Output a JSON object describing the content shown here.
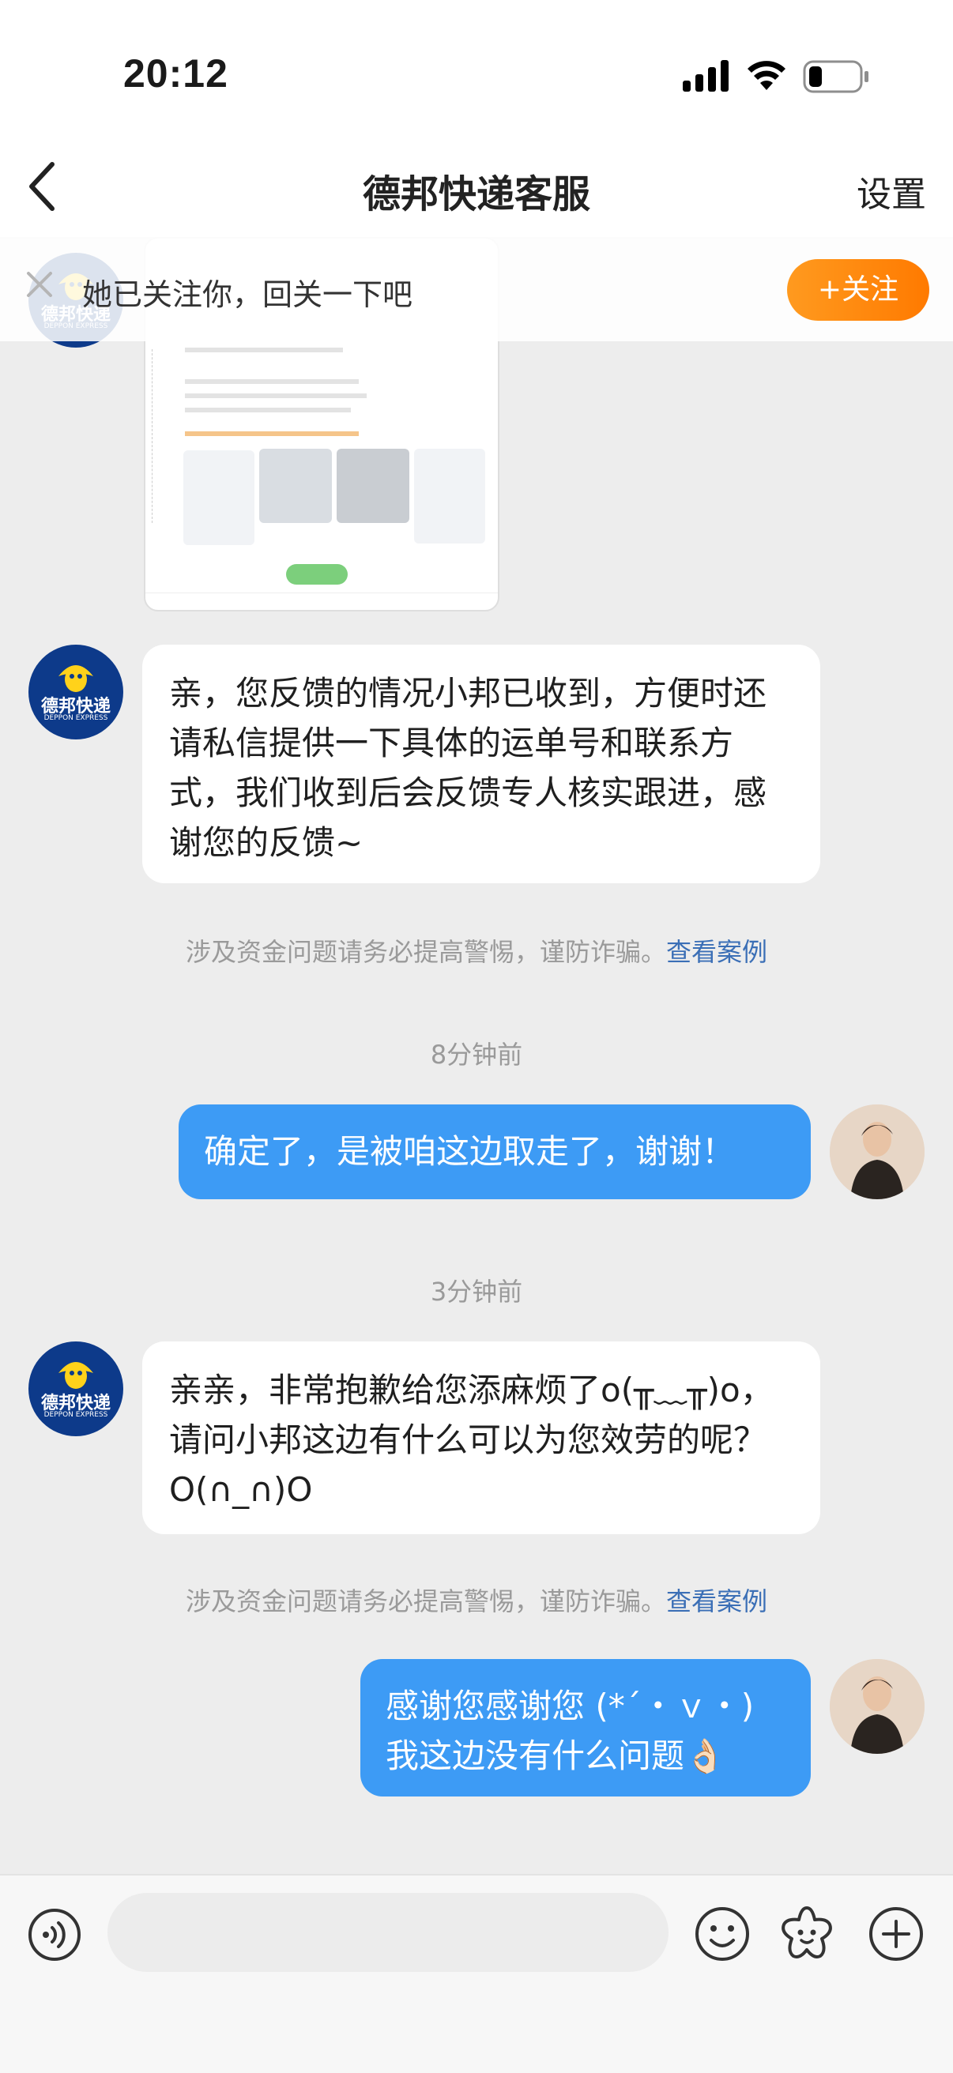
{
  "status_bar": {
    "time": "20:12"
  },
  "nav": {
    "title": "德邦快递客服",
    "settings_label": "设置"
  },
  "follow_banner": {
    "text": "她已关注你，回关一下吧",
    "follow_label": "+关注"
  },
  "bot": {
    "brand_cn": "德邦快递",
    "brand_en": "DEPPON EXPRESS"
  },
  "messages": [
    {
      "sender": "bot",
      "text": "亲，您反馈的情况小邦已收到，方便时还请私信提供一下具体的运单号和联系方式，我们收到后会反馈专人核实跟进，感谢您的反馈~"
    },
    {
      "sender": "user",
      "text": "确定了，是被咱这边取走了，谢谢！"
    },
    {
      "sender": "bot",
      "text": "亲亲，非常抱歉给您添麻烦了o(╥﹏╥)o，请问小邦这边有什么可以为您效劳的呢？O(∩_∩)O"
    },
    {
      "sender": "user",
      "text": "感谢您感谢您 (*´・ｖ・)\n我这边没有什么问题👌🏻"
    }
  ],
  "warnings": {
    "text": "涉及资金问题请务必提高警惕，谨防诈骗。",
    "link": "查看案例"
  },
  "timestamps": [
    "8分钟前",
    "3分钟前"
  ],
  "colors": {
    "accent_blue": "#3d9bf5",
    "follow_orange": "#ff8a00",
    "link_blue": "#3b6fb6"
  }
}
